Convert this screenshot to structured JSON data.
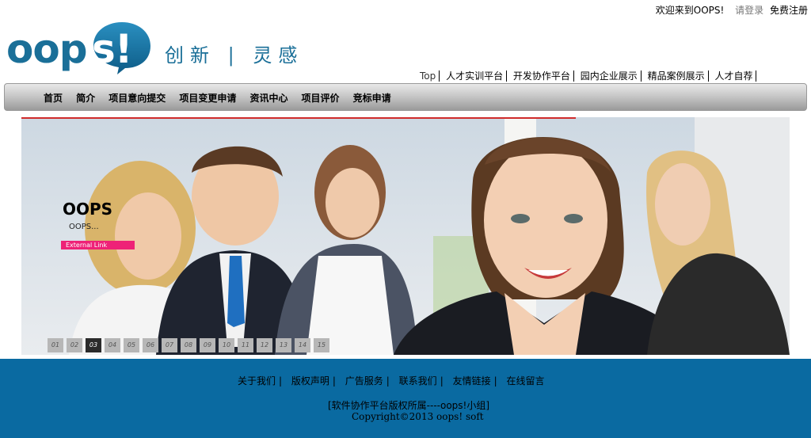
{
  "topbar": {
    "welcome": "欢迎来到OOPS!",
    "login": "请登录",
    "register": "免费注册"
  },
  "logo": {
    "text_left": "oop",
    "text_bubble": "s!",
    "slogan": "创新 | 灵感"
  },
  "sublinks": [
    "Top",
    "人才实训平台",
    "开发协作平台",
    "园内企业展示",
    "精品案例展示",
    "人才自荐"
  ],
  "nav": [
    "首页",
    "简介",
    "项目意向提交",
    "项目变更申请",
    "资讯中心",
    "项目评价",
    "竞标申请"
  ],
  "banner": {
    "title": "OOPS",
    "subtitle": "OOPS...",
    "link": "External Link",
    "pages": [
      "01",
      "02",
      "03",
      "04",
      "05",
      "06",
      "07",
      "08",
      "09",
      "10",
      "11",
      "12",
      "13",
      "14",
      "15"
    ],
    "active_page": "03"
  },
  "footer": {
    "links": [
      "关于我们",
      "版权声明",
      "广告服务",
      "联系我们",
      "友情链接",
      "在线留言"
    ],
    "line1": "[软件协作平台版权所属----oops!小组]",
    "line2": "Copyright©2013 oops! soft"
  },
  "colors": {
    "brand_blue": "#1a6f98",
    "footer_bg": "#0a6aa1",
    "accent_pink": "#ee2277",
    "accent_red": "#d02c2c"
  }
}
